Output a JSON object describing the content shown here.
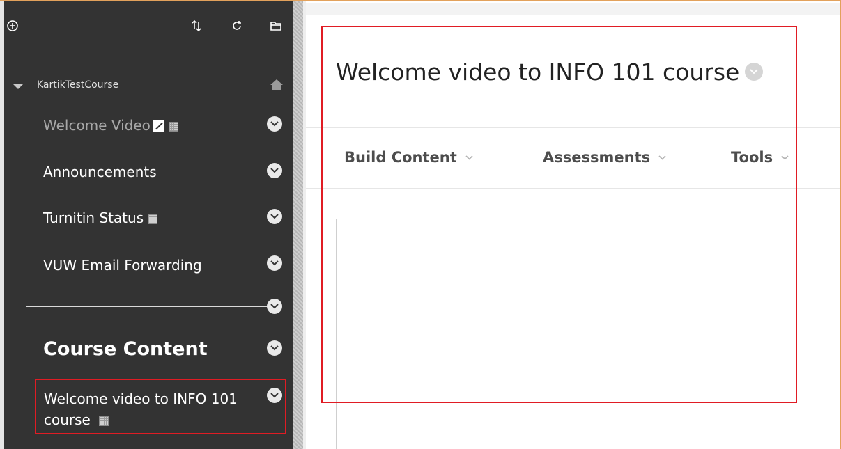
{
  "sidebar": {
    "toolbar": {
      "add": "add-icon",
      "reorder": "reorder-icon",
      "refresh": "refresh-icon",
      "folder": "folder-icon"
    },
    "course_name": "KartikTestCourse",
    "items": [
      {
        "label": "Welcome Video"
      },
      {
        "label": "Announcements"
      },
      {
        "label": "Turnitin Status"
      },
      {
        "label": "VUW Email Forwarding"
      }
    ],
    "section_heading": "Course Content",
    "selected_item": {
      "label": "Welcome video to INFO 101 course"
    }
  },
  "main": {
    "page_title": "Welcome video to INFO 101 course",
    "action_bar": [
      {
        "label": "Build Content"
      },
      {
        "label": "Assessments"
      },
      {
        "label": "Tools"
      }
    ]
  },
  "colors": {
    "sidebar_bg": "#333333",
    "highlight": "#e01c24",
    "frame_border": "#e2a15b"
  }
}
